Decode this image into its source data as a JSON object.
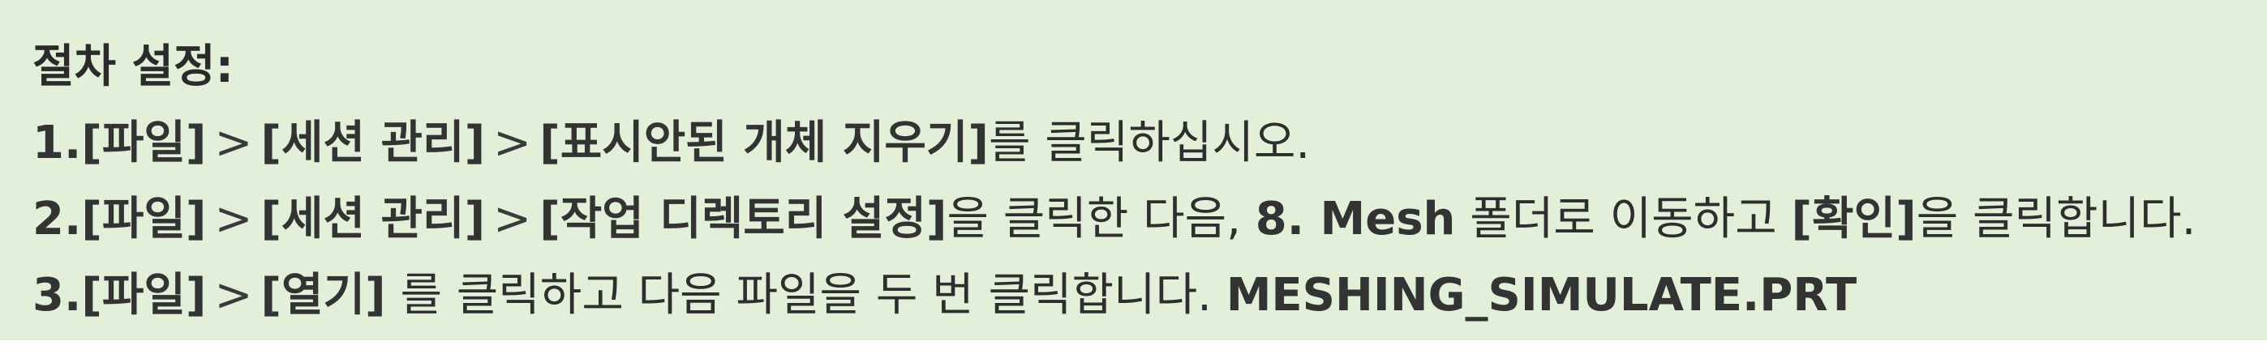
{
  "heading": "절차 설정:",
  "steps": [
    {
      "num": "1.",
      "menu1": "[파일]",
      "sep1": ">",
      "menu2": "[세션 관리]",
      "sep2": ">",
      "menu3": "[표시안된 개체 지우기]",
      "tail": "를 클릭하십시오."
    },
    {
      "num": "2.",
      "menu1": "[파일]",
      "sep1": ">",
      "menu2": "[세션 관리]",
      "sep2": ">",
      "menu3": "[작업 디렉토리 설정]",
      "mid1": "을 클릭한 다음, ",
      "folder": "8. Mesh",
      "mid2": " 폴더로 이동하고 ",
      "ok": "[확인]",
      "tail": "을 클릭합니다."
    },
    {
      "num": "3.",
      "menu1": "[파일]",
      "sep1": ">",
      "menu2": "[열기]",
      "mid1": " 를 클릭하고 다음 파일을 두 번 클릭합니다. ",
      "file": "MESHING_SIMULATE.PRT"
    }
  ]
}
